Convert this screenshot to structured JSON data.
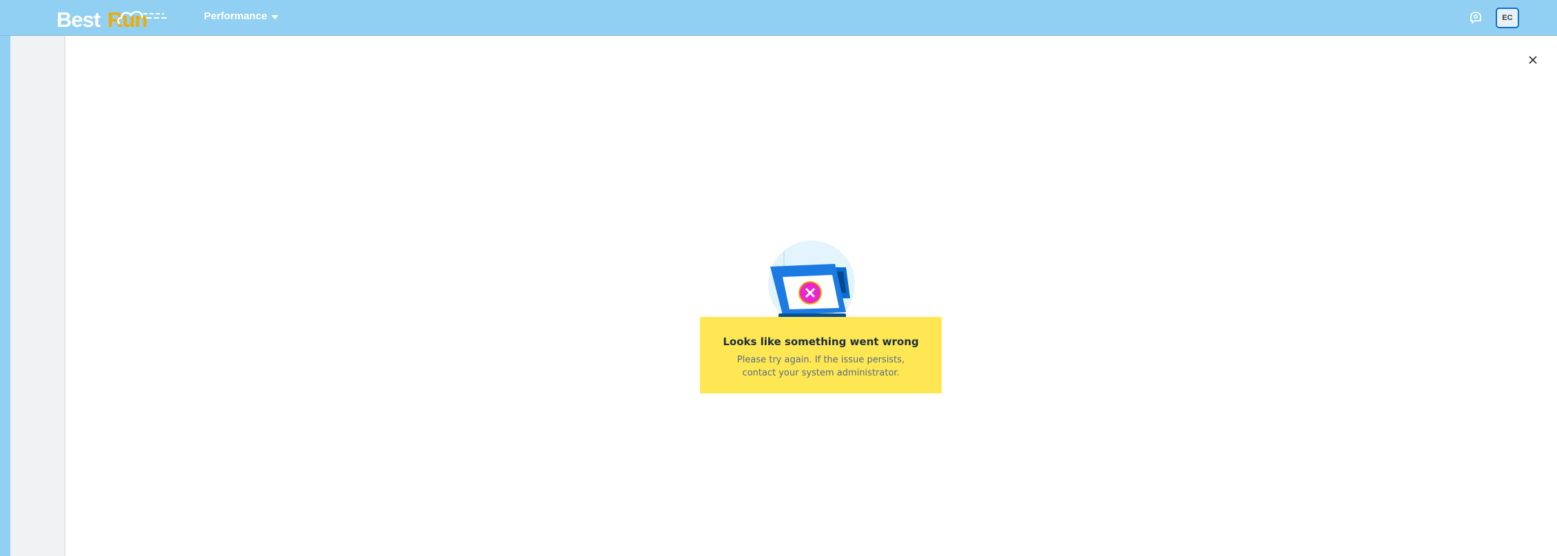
{
  "header": {
    "logo_part1": "Best",
    "logo_part2": "Run",
    "product_menu_label": "Performance",
    "avatar_initials": "EC"
  },
  "error": {
    "title": "Looks like something went wrong",
    "message": "Please try again. If the issue persists, contact your system administrator."
  },
  "icons": {
    "notifications": "notifications-icon",
    "close": "close-icon",
    "menu_caret": "chevron-down-icon",
    "error_illustration": "broken-laptop-error-icon"
  },
  "colors": {
    "header_bg": "#91d0f2",
    "brand_accent": "#f0ab00",
    "error_box_bg": "#ffe753",
    "error_badge": "#e927c9",
    "laptop_blue": "#0a6ed1"
  }
}
